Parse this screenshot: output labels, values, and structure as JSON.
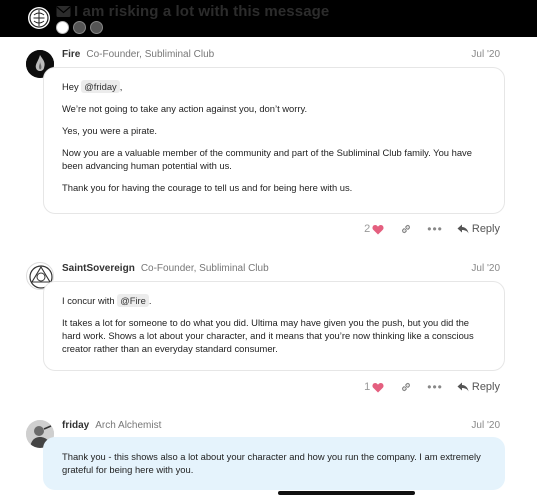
{
  "topic": {
    "title": "I am risking a lot with this message",
    "participants": [
      "participant-1",
      "participant-2",
      "participant-3"
    ]
  },
  "posts": [
    {
      "username": "Fire",
      "user_title": "Co-Founder, Subliminal Club",
      "date": "Jul '20",
      "greeting_prefix": "Hey",
      "mention": "@friday",
      "greeting_suffix": ",",
      "paragraphs": [
        "We’re not going to take any action against you, don’t worry.",
        "Yes, you were a pirate.",
        "Now you are a valuable member of the community and part of the Subliminal Club family. You have been advancing human potential with us.",
        "Thank you for having the courage to tell us and for being here with us."
      ],
      "likes": "2",
      "reply_label": "Reply"
    },
    {
      "username": "SaintSovereign",
      "user_title": "Co-Founder, Subliminal Club",
      "date": "Jul '20",
      "greeting_prefix": "I concur with",
      "mention": "@Fire",
      "greeting_suffix": ".",
      "paragraphs": [
        "It takes a lot for someone to do what you did. Ultima may have given you the push, but you did the hard work. Shows a lot about your character, and it means that you’re now thinking like a conscious creator rather than an everyday standard consumer."
      ],
      "likes": "1",
      "reply_label": "Reply"
    },
    {
      "username": "friday",
      "user_title": "Arch Alchemist",
      "date": "Jul '20",
      "paragraphs": [
        "Thank you - this shows also a lot about your character and how you run the company. I am extremely grateful for being here with you."
      ]
    }
  ],
  "colors": {
    "header_bg": "#000000",
    "heart": "#e45f7f",
    "highlight_bubble": "#e5f3fc"
  }
}
